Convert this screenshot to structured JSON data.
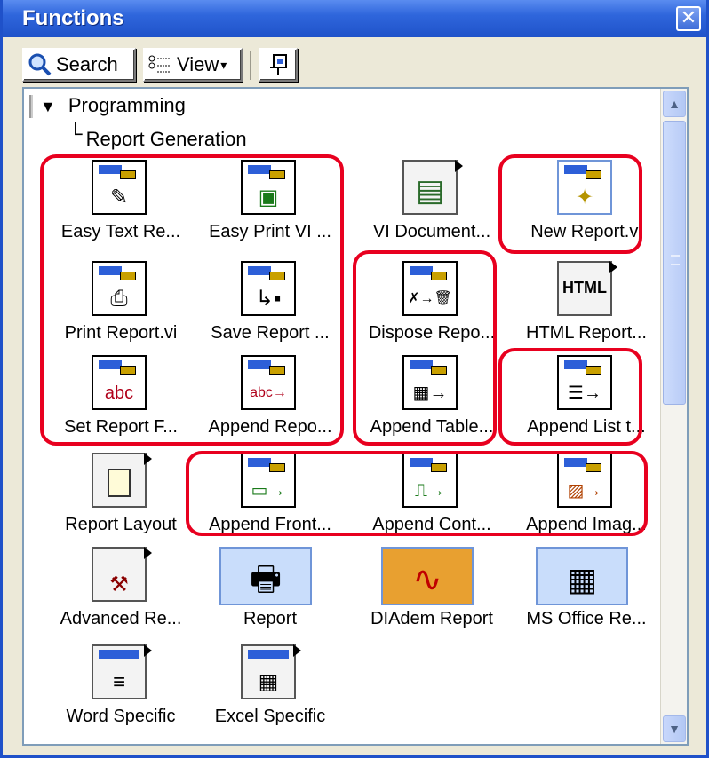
{
  "window": {
    "title": "Functions",
    "close_glyph": "✕"
  },
  "toolbar": {
    "search_label": "Search",
    "view_label": "View",
    "view_arrow": "▾"
  },
  "tree": {
    "expander": "▼",
    "root": "Programming",
    "child_connector": "└",
    "child": "Report Generation"
  },
  "items": [
    {
      "label": "Easy Text Re...",
      "icon": "pencil-report-icon",
      "glyph": "✎"
    },
    {
      "label": "Easy Print VI ...",
      "icon": "print-vi-icon",
      "glyph": "▣"
    },
    {
      "label": "VI Document...",
      "icon": "vi-documentation-icon",
      "glyph": "▤"
    },
    {
      "label": "New Report.vi",
      "icon": "new-report-icon",
      "glyph": "✦"
    },
    {
      "label": "Print Report.vi",
      "icon": "printer-icon",
      "glyph": "⎙"
    },
    {
      "label": "Save Report ...",
      "icon": "floppy-disk-icon",
      "glyph": "↳▪"
    },
    {
      "label": "Dispose Repo...",
      "icon": "trash-icon",
      "glyph": "✗→🗑"
    },
    {
      "label": "HTML Report...",
      "icon": "html-palette-icon",
      "glyph": "HTML"
    },
    {
      "label": "Set Report F...",
      "icon": "font-icon",
      "glyph": "abc"
    },
    {
      "label": "Append Repo...",
      "icon": "append-text-icon",
      "glyph": "abc→"
    },
    {
      "label": "Append Table...",
      "icon": "append-table-icon",
      "glyph": "▦→"
    },
    {
      "label": "Append List t...",
      "icon": "append-list-icon",
      "glyph": "☰→"
    },
    {
      "label": "Report Layout",
      "icon": "layout-palette-icon",
      "glyph": "▢"
    },
    {
      "label": "Append Front...",
      "icon": "append-front-panel-icon",
      "glyph": "▭→"
    },
    {
      "label": "Append Cont...",
      "icon": "append-control-icon",
      "glyph": "⎍→"
    },
    {
      "label": "Append Imag...",
      "icon": "append-image-icon",
      "glyph": "▨→"
    },
    {
      "label": "Advanced Re...",
      "icon": "hammer-palette-icon",
      "glyph": "⚒"
    },
    {
      "label": "Report",
      "icon": "report-printer-icon",
      "glyph": "🖶"
    },
    {
      "label": "DIAdem Report",
      "icon": "diadem-icon",
      "glyph": "∿"
    },
    {
      "label": "MS Office Re...",
      "icon": "ms-office-icon",
      "glyph": "▦"
    },
    {
      "label": "Word Specific",
      "icon": "word-palette-icon",
      "glyph": "≡"
    },
    {
      "label": "Excel Specific",
      "icon": "excel-palette-icon",
      "glyph": "▦"
    }
  ],
  "colors": {
    "highlight": "#e8001f",
    "titlebar": "#2f66dc",
    "panel_bg": "#ffffff"
  }
}
